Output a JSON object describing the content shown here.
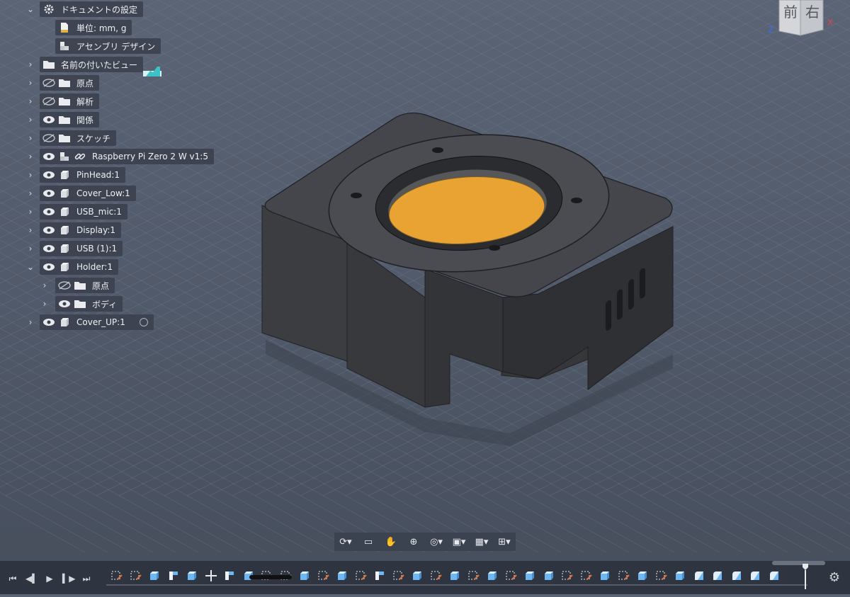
{
  "browser": {
    "items": [
      {
        "label": "ドキュメントの設定",
        "chevron": "expanded"
      },
      {
        "label": "単位: mm, g"
      },
      {
        "label": "アセンブリ デザイン"
      },
      {
        "label": "名前の付いたビュー",
        "chevron": "collapsed"
      },
      {
        "label": "原点",
        "chevron": "collapsed",
        "visibility": "hidden"
      },
      {
        "label": "解析",
        "chevron": "collapsed",
        "visibility": "hidden"
      },
      {
        "label": "関係",
        "chevron": "collapsed",
        "visibility": "visible"
      },
      {
        "label": "スケッチ",
        "chevron": "collapsed",
        "visibility": "hidden"
      },
      {
        "label": "Raspberry Pi Zero 2 W v1:5",
        "chevron": "collapsed",
        "visibility": "visible"
      },
      {
        "label": "PinHead:1",
        "chevron": "collapsed",
        "visibility": "visible"
      },
      {
        "label": "Cover_Low:1",
        "chevron": "collapsed",
        "visibility": "visible"
      },
      {
        "label": "USB_mic:1",
        "chevron": "collapsed",
        "visibility": "visible"
      },
      {
        "label": "Display:1",
        "chevron": "collapsed",
        "visibility": "visible"
      },
      {
        "label": "USB (1):1",
        "chevron": "collapsed",
        "visibility": "visible"
      },
      {
        "label": "Holder:1",
        "chevron": "expanded",
        "visibility": "visible"
      },
      {
        "label": "原点",
        "chevron": "collapsed",
        "visibility": "hidden"
      },
      {
        "label": "ボディ",
        "chevron": "collapsed",
        "visibility": "visible"
      },
      {
        "label": "Cover_UP:1",
        "chevron": "collapsed",
        "visibility": "visible"
      }
    ]
  },
  "viewcube": {
    "front_label": "前",
    "right_label": "右",
    "axis_z": "Z",
    "axis_x": "X"
  },
  "colors": {
    "background": "#525b6b",
    "grid": "#6e7889",
    "body": "#3f4044",
    "insert": "#e9a332",
    "panel": "#3a404c"
  },
  "navbar": {
    "icons": [
      "orbit-icon",
      "look-at-icon",
      "pan-icon",
      "zoom-icon",
      "fit-icon",
      "display-settings-icon",
      "grid-settings-icon",
      "viewports-icon"
    ]
  },
  "timeline": {
    "controls": [
      "go-to-start-icon",
      "step-back-icon",
      "play-icon",
      "step-forward-icon",
      "go-to-end-icon"
    ]
  }
}
